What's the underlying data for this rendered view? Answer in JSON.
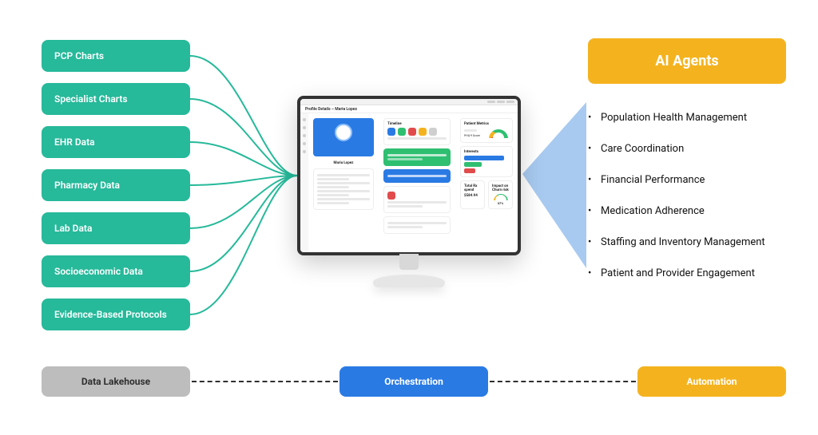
{
  "sources": [
    "PCP Charts",
    "Specialist Charts",
    "EHR Data",
    "Pharmacy Data",
    "Lab Data",
    "Socioeconomic Data",
    "Evidence-Based Protocols"
  ],
  "ai_agents_header": "AI Agents",
  "ai_agents_items": [
    "Population Health Management",
    "Care Coordination",
    "Financial Performance",
    "Medication Adherence",
    "Staffing and Inventory Management",
    "Patient and Provider Engagement"
  ],
  "bottom": {
    "lakehouse": "Data Lakehouse",
    "orchestration": "Orchestration",
    "automation": "Automation"
  },
  "screen": {
    "title": "Profile Details – Maria Lopez",
    "patient_name": "Maria Lopez",
    "timeline_title": "Timeline",
    "metrics_title": "Patient Metrics",
    "interests_title": "Interests",
    "rx_spend_title": "Total Rx spend",
    "rx_spend_value": "$584.94",
    "churn_title": "Impact on Churn risk",
    "churn_value": "37%",
    "phq_label": "PHQ-9 Score"
  },
  "colors": {
    "teal": "#26b99a",
    "blue": "#2a7ae4",
    "orange": "#f4b31e",
    "gray": "#bdbdbd",
    "light_blue": "#9fc4ee"
  }
}
